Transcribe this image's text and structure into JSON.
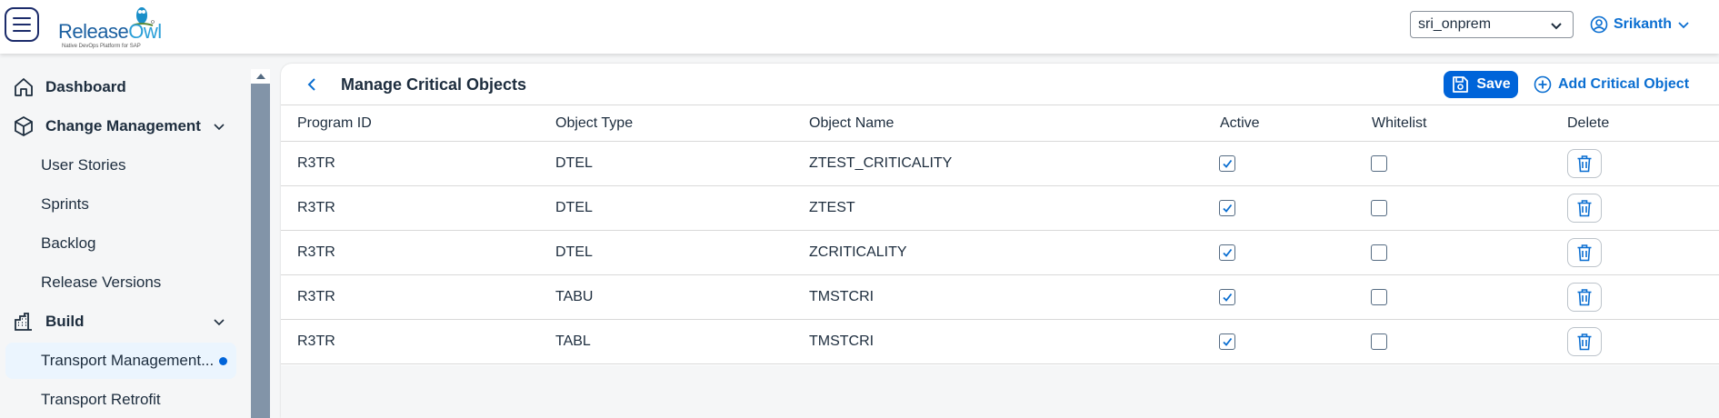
{
  "header": {
    "logo_text_main": "Release",
    "logo_text_accent": "Owl",
    "logo_tagline": "Native DevOps Platform for SAP",
    "system_selected": "sri_onprem",
    "user_name": "Srikanth"
  },
  "sidebar": {
    "items": [
      {
        "label": "Dashboard",
        "icon": "home-icon"
      },
      {
        "label": "Change Management",
        "icon": "change-management-icon"
      },
      {
        "label": "User Stories"
      },
      {
        "label": "Sprints"
      },
      {
        "label": "Backlog"
      },
      {
        "label": "Release Versions"
      },
      {
        "label": "Build",
        "icon": "build-icon"
      },
      {
        "label": "Transport Management..."
      },
      {
        "label": "Transport Retrofit"
      }
    ]
  },
  "page": {
    "title": "Manage Critical Objects",
    "save_label": "Save",
    "add_label": "Add Critical Object"
  },
  "table": {
    "columns": [
      "Program ID",
      "Object Type",
      "Object Name",
      "Active",
      "Whitelist",
      "Delete"
    ],
    "rows": [
      {
        "program_id": "R3TR",
        "object_type": "DTEL",
        "object_name": "ZTEST_CRITICALITY",
        "active": true,
        "whitelist": false
      },
      {
        "program_id": "R3TR",
        "object_type": "DTEL",
        "object_name": "ZTEST",
        "active": true,
        "whitelist": false
      },
      {
        "program_id": "R3TR",
        "object_type": "DTEL",
        "object_name": "ZCRITICALITY",
        "active": true,
        "whitelist": false
      },
      {
        "program_id": "R3TR",
        "object_type": "TABU",
        "object_name": "TMSTCRI",
        "active": true,
        "whitelist": false
      },
      {
        "program_id": "R3TR",
        "object_type": "TABL",
        "object_name": "TMSTCRI",
        "active": true,
        "whitelist": false
      }
    ]
  },
  "colors": {
    "accent": "#0064d9",
    "link": "#0a6ed1",
    "selected_bg": "#ebf5fe"
  }
}
